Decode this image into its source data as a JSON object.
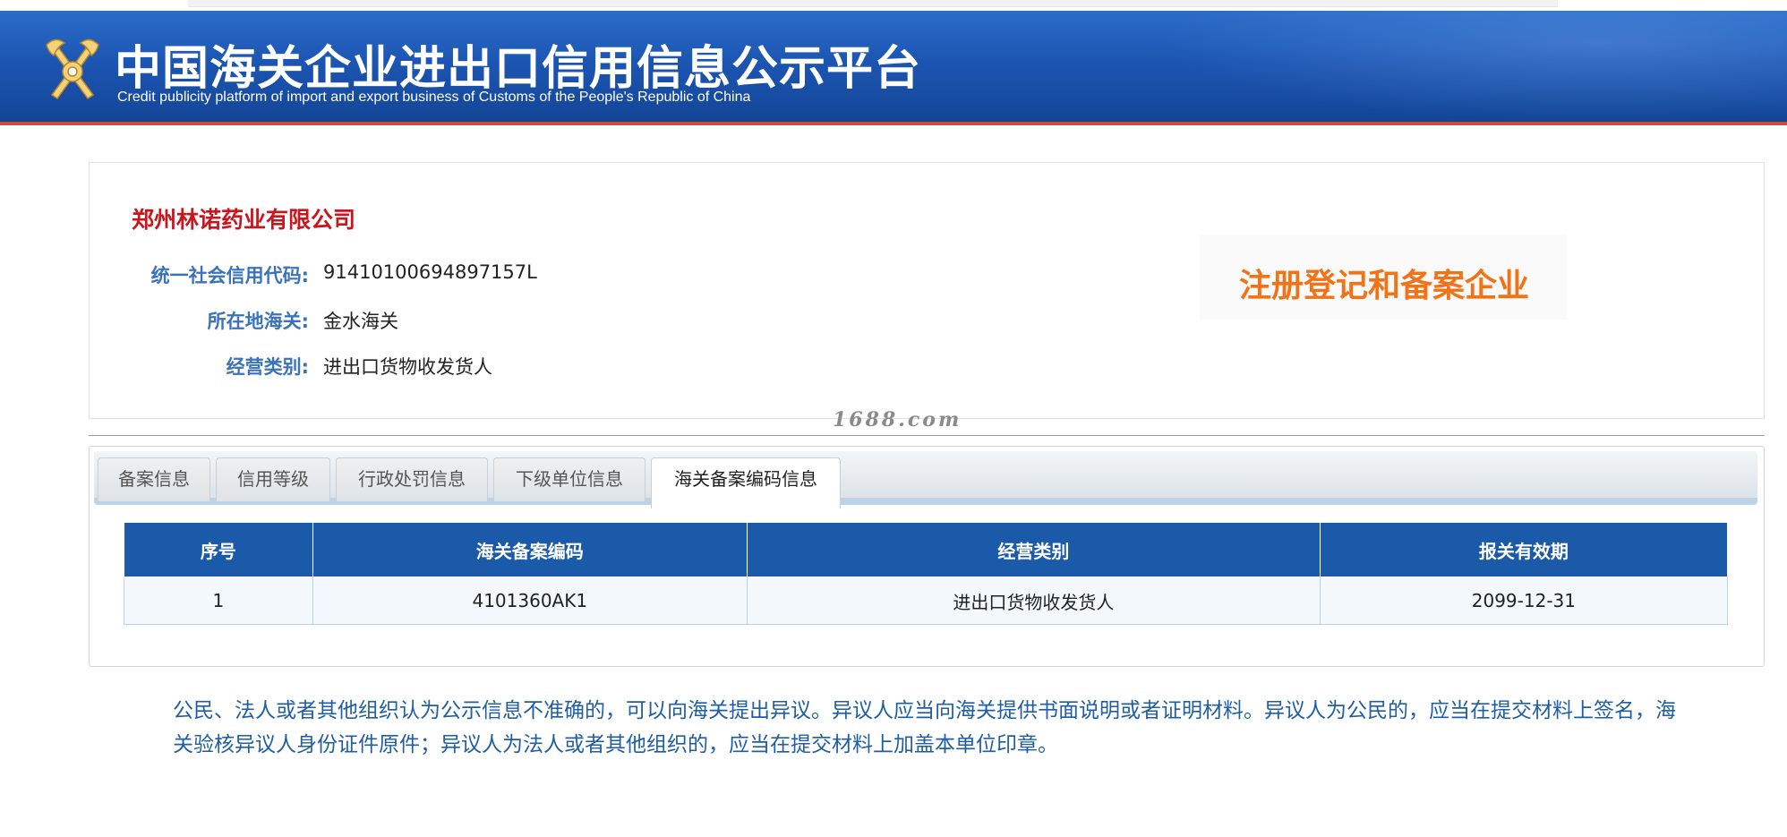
{
  "header": {
    "title_cn": "中国海关企业进出口信用信息公示平台",
    "title_en": "Credit publicity platform of import and export business of Customs of the People's Republic of China"
  },
  "company": {
    "name": "郑州林诺药业有限公司",
    "fields": [
      {
        "label": "统一社会信用代码:",
        "value": "91410100694897157L"
      },
      {
        "label": "所在地海关:",
        "value": "金水海关"
      },
      {
        "label": "经营类别:",
        "value": "进出口货物收发货人"
      }
    ],
    "status_stamp": "注册登记和备案企业"
  },
  "watermark": "1688.com",
  "tabs": [
    {
      "label": "备案信息",
      "active": false
    },
    {
      "label": "信用等级",
      "active": false
    },
    {
      "label": "行政处罚信息",
      "active": false
    },
    {
      "label": "下级单位信息",
      "active": false
    },
    {
      "label": "海关备案编码信息",
      "active": true
    }
  ],
  "table": {
    "headers": [
      "序号",
      "海关备案编码",
      "经营类别",
      "报关有效期"
    ],
    "rows": [
      [
        "1",
        "4101360AK1",
        "进出口货物收发货人",
        "2099-12-31"
      ]
    ]
  },
  "notice": "公民、法人或者其他组织认为公示信息不准确的，可以向海关提出异议。异议人应当向海关提供书面说明或者证明材料。异议人为公民的，应当在提交材料上签名，海关验核异议人身份证件原件；异议人为法人或者其他组织的，应当在提交材料上加盖本单位印章。",
  "colors": {
    "banner_blue": "#1c56b3",
    "company_red": "#c8161d",
    "label_blue": "#3a73b8",
    "stamp_orange": "#f07318",
    "table_header": "#1b5aa8"
  }
}
